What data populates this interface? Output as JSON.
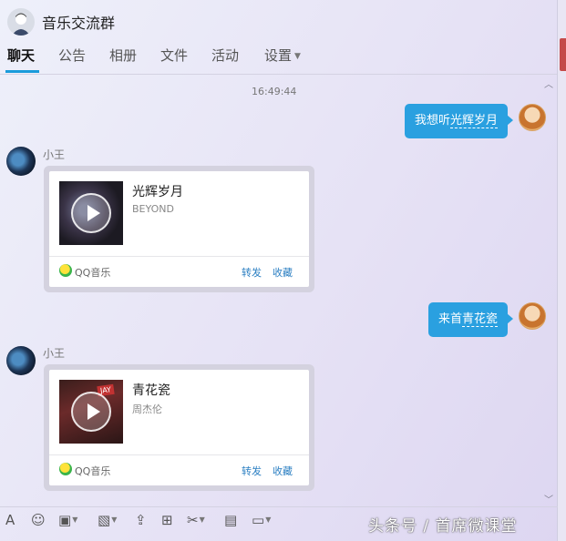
{
  "header": {
    "group_name": "音乐交流群",
    "tabs": [
      {
        "label": "聊天",
        "active": true
      },
      {
        "label": "公告"
      },
      {
        "label": "相册"
      },
      {
        "label": "文件"
      },
      {
        "label": "活动"
      },
      {
        "label": "设置"
      }
    ]
  },
  "chat": {
    "timestamp": "16:49:44",
    "messages": [
      {
        "type": "outgoing",
        "text_prefix": "我想听",
        "text_link": "光辉岁月"
      },
      {
        "type": "music_card",
        "sender": "小王",
        "song": "光辉岁月",
        "artist": "BEYOND",
        "source": "QQ音乐",
        "forward_label": "转发",
        "collect_label": "收藏"
      },
      {
        "type": "outgoing",
        "text_prefix": "来首",
        "text_link": "青花瓷"
      },
      {
        "type": "music_card",
        "sender": "小王",
        "song": "青花瓷",
        "artist": "周杰伦",
        "source": "QQ音乐",
        "forward_label": "转发",
        "collect_label": "收藏",
        "cover_tag": "JAY"
      }
    ]
  },
  "toolbar": {
    "tools": [
      "font-icon",
      "emoji-icon",
      "gif-icon",
      "image-icon",
      "upload-icon",
      "gift-icon",
      "scissors-icon",
      "history-icon",
      "more-icon"
    ]
  },
  "watermark": "头条号 / 首席微课堂",
  "colors": {
    "accent": "#1a9bdb",
    "bubble": "#2aa0e0",
    "link": "#2b7fc2"
  }
}
